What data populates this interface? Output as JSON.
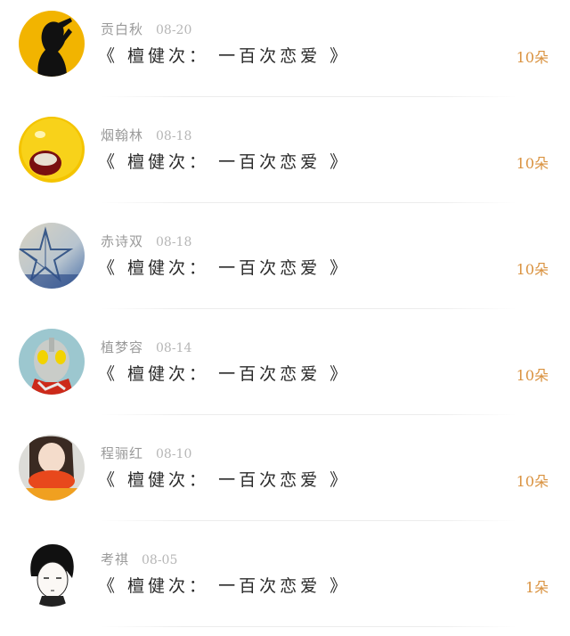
{
  "rows": [
    {
      "name": "贡白秋",
      "date": "08-20",
      "title": "《 檀健次： 一百次恋爱 》",
      "count": "10朵",
      "avatar": "silhouette-woman-avatar"
    },
    {
      "name": "烟翰林",
      "date": "08-18",
      "title": "《 檀健次： 一百次恋爱 》",
      "count": "10朵",
      "avatar": "yellow-face-avatar"
    },
    {
      "name": "赤诗双",
      "date": "08-18",
      "title": "《 檀健次： 一百次恋爱 》",
      "count": "10朵",
      "avatar": "star-ornament-avatar"
    },
    {
      "name": "植梦容",
      "date": "08-14",
      "title": "《 檀健次： 一百次恋爱 》",
      "count": "10朵",
      "avatar": "robot-hero-avatar"
    },
    {
      "name": "程骊红",
      "date": "08-10",
      "title": "《 檀健次： 一百次恋爱 》",
      "count": "10朵",
      "avatar": "girl-red-scarf-avatar"
    },
    {
      "name": "考祺",
      "date": "08-05",
      "title": "《 檀健次： 一百次恋爱 》",
      "count": "1朵",
      "avatar": "anime-boy-avatar"
    }
  ],
  "colors": {
    "count": "#d9913e",
    "name": "#9a9a9a",
    "title": "#2a2a2a"
  }
}
